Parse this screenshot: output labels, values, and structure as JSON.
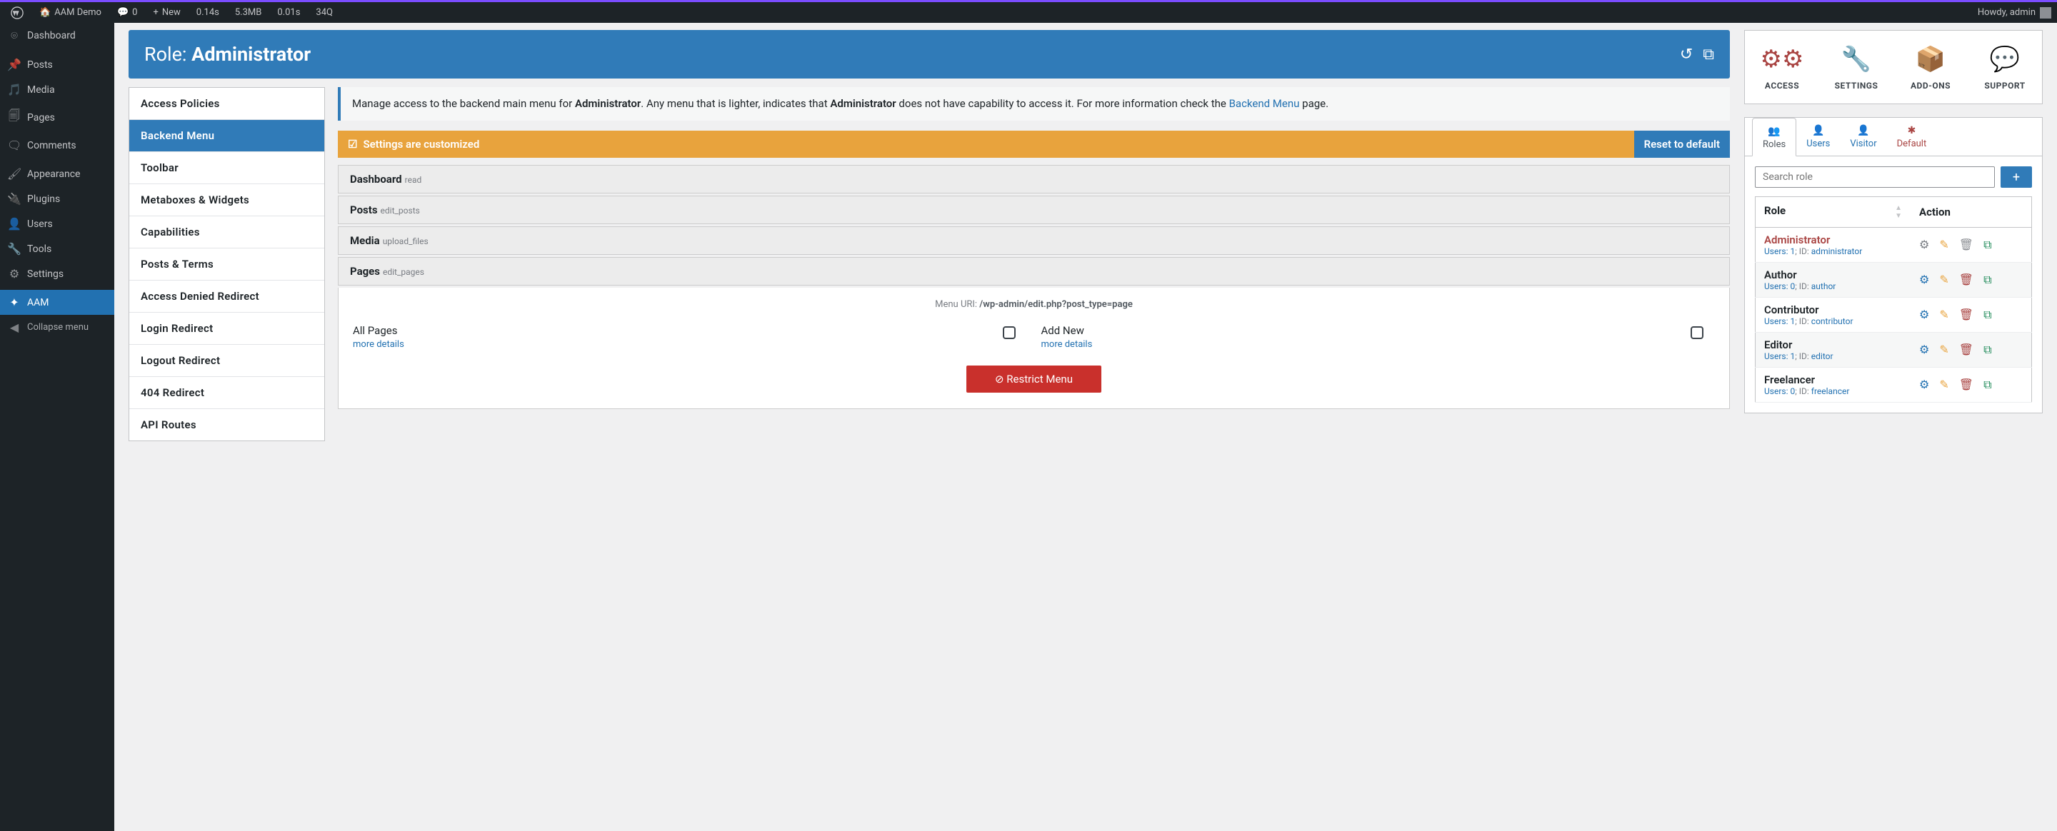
{
  "topbar": {
    "site": "AAM Demo",
    "comments": "0",
    "new": "New",
    "stat1": "0.14s",
    "stat2": "5.3MB",
    "stat3": "0.01s",
    "stat4": "34Q",
    "howdy": "Howdy, admin"
  },
  "sidebar": {
    "items": [
      {
        "label": "Dashboard",
        "icon": "🏠"
      },
      {
        "label": "Posts",
        "icon": "📌"
      },
      {
        "label": "Media",
        "icon": "🖼"
      },
      {
        "label": "Pages",
        "icon": "📄"
      },
      {
        "label": "Comments",
        "icon": "💬"
      },
      {
        "label": "Appearance",
        "icon": "🖌"
      },
      {
        "label": "Plugins",
        "icon": "🔌"
      },
      {
        "label": "Users",
        "icon": "👤"
      },
      {
        "label": "Tools",
        "icon": "🔧"
      },
      {
        "label": "Settings",
        "icon": "⚙"
      },
      {
        "label": "AAM",
        "icon": "✦"
      }
    ],
    "collapse": "Collapse menu"
  },
  "header": {
    "prefix": "Role:",
    "name": "Administrator"
  },
  "features": [
    "Access Policies",
    "Backend Menu",
    "Toolbar",
    "Metaboxes & Widgets",
    "Capabilities",
    "Posts & Terms",
    "Access Denied Redirect",
    "Login Redirect",
    "Logout Redirect",
    "404 Redirect",
    "API Routes"
  ],
  "info": {
    "text1": "Manage access to the backend main menu for ",
    "role": "Administrator",
    "text2": ". Any menu that is lighter, indicates that ",
    "text3": " does not have capability to access it. For more information check the ",
    "link": "Backend Menu",
    "text4": " page."
  },
  "customized": {
    "label": "Settings are customized",
    "reset": "Reset to default"
  },
  "menu": {
    "items": [
      {
        "name": "Dashboard",
        "cap": "read"
      },
      {
        "name": "Posts",
        "cap": "edit_posts"
      },
      {
        "name": "Media",
        "cap": "upload_files"
      },
      {
        "name": "Pages",
        "cap": "edit_pages"
      }
    ],
    "uri_label": "Menu URI: ",
    "uri": "/wp-admin/edit.php?post_type=page",
    "sub1": "All Pages",
    "sub2": "Add New",
    "more": "more details",
    "restrict": "Restrict Menu"
  },
  "tiles": [
    {
      "label": "ACCESS",
      "color": "c-red"
    },
    {
      "label": "SETTINGS",
      "color": ""
    },
    {
      "label": "ADD-ONS",
      "color": ""
    },
    {
      "label": "SUPPORT",
      "color": ""
    }
  ],
  "subjectTabs": [
    "Roles",
    "Users",
    "Visitor",
    "Default"
  ],
  "search_placeholder": "Search role",
  "table": {
    "col1": "Role",
    "col2": "Action",
    "rows": [
      {
        "name": "Administrator",
        "users": "1",
        "id": "administrator",
        "current": true
      },
      {
        "name": "Author",
        "users": "0",
        "id": "author"
      },
      {
        "name": "Contributor",
        "users": "1",
        "id": "contributor"
      },
      {
        "name": "Editor",
        "users": "1",
        "id": "editor"
      },
      {
        "name": "Freelancer",
        "users": "0",
        "id": "freelancer"
      }
    ],
    "meta_users": "Users: ",
    "meta_id": "; ID: "
  }
}
